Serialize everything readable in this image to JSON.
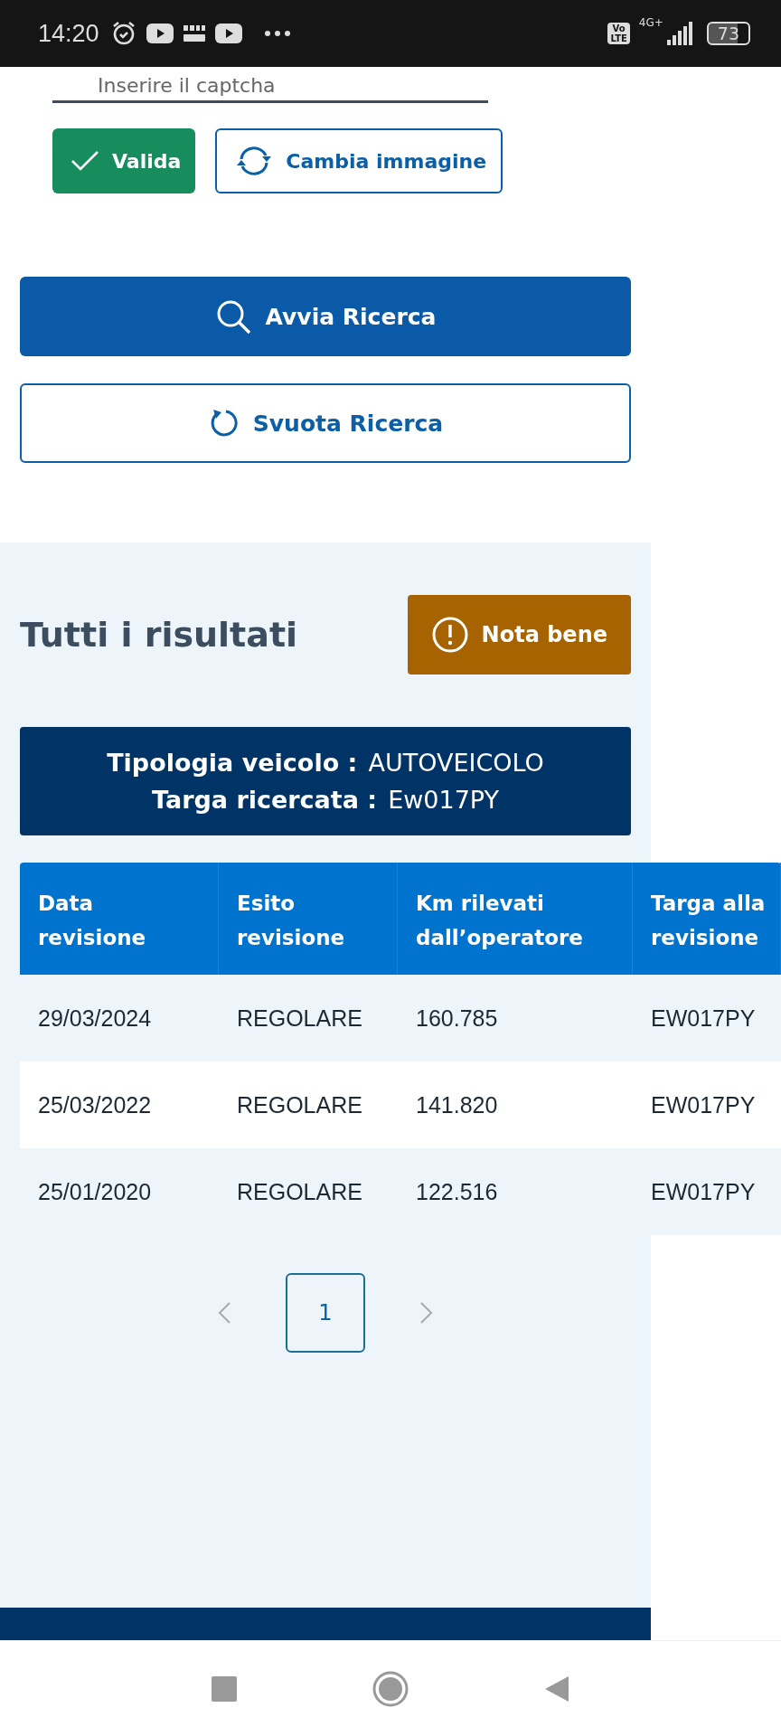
{
  "status_bar": {
    "time": "14:20",
    "volte": [
      "Vo",
      "LTE"
    ],
    "network": "4G+",
    "battery": "73"
  },
  "captcha": {
    "placeholder": "Inserire il captcha"
  },
  "captcha_buttons": [
    {
      "kind": "confirm",
      "label": "Valida"
    },
    {
      "kind": "refresh",
      "label": "Cambia immagine"
    }
  ],
  "search_buttons": [
    {
      "kind": "primary",
      "label": "Avvia Ricerca"
    },
    {
      "kind": "reset",
      "label": "Svuota Ricerca"
    }
  ],
  "results": {
    "title": "Tutti i risultati",
    "note_button": "Nota bene",
    "info": [
      {
        "label": "Tipologia veicolo :",
        "value": "AUTOVEICOLO"
      },
      {
        "label": "Targa ricercata :",
        "value": "Ew017PY"
      }
    ],
    "table": {
      "columns": [
        "Data\nrevisione",
        "Esito\nrevisione",
        "Km rilevati\ndall’operatore",
        "Targa alla\nrevisione"
      ],
      "rows": [
        [
          "29/03/2024",
          "REGOLARE",
          "160.785",
          "EW017PY"
        ],
        [
          "25/03/2022",
          "REGOLARE",
          "141.820",
          "EW017PY"
        ],
        [
          "25/01/2020",
          "REGOLARE",
          "122.516",
          "EW017PY"
        ]
      ]
    },
    "pagination": {
      "pages": [
        {
          "label": "1",
          "selected": true
        }
      ]
    }
  }
}
